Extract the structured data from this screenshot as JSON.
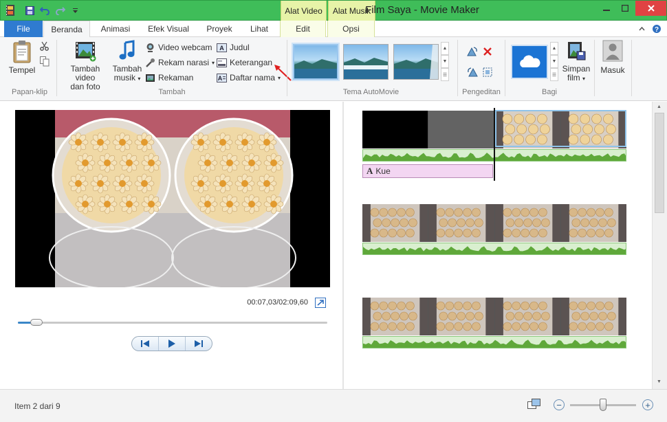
{
  "window": {
    "title": "Film Saya - Movie Maker",
    "context_tabs": [
      "Alat Video",
      "Alat Musik"
    ]
  },
  "tabs": {
    "file": "File",
    "items": [
      "Beranda",
      "Animasi",
      "Efek Visual",
      "Proyek",
      "Lihat"
    ],
    "video_edit": "Edit",
    "music_options": "Opsi"
  },
  "ribbon": {
    "clipboard": {
      "paste_label": "Tempel",
      "group_label": "Papan-klip"
    },
    "add": {
      "add_video_label_1": "Tambah video",
      "add_video_label_2": "dan foto",
      "add_music_label_1": "Tambah",
      "add_music_label_2": "musik",
      "webcam_video": "Video webcam",
      "record_narration": "Rekam narasi",
      "snapshot": "Rekaman",
      "title": "Judul",
      "caption": "Keterangan",
      "credits": "Daftar nama",
      "group_label": "Tambah"
    },
    "automovie_themes": {
      "group_label": "Tema AutoMovie"
    },
    "editing": {
      "group_label": "Pengeditan"
    },
    "share": {
      "save_movie_label_1": "Simpan",
      "save_movie_label_2": "film",
      "group_label": "Bagi"
    },
    "sign_in": {
      "label": "Masuk"
    }
  },
  "preview": {
    "time": "00:07,03/02:09,60",
    "seek_progress": 0.055
  },
  "storyboard": {
    "caption_clip_text": "Kue"
  },
  "status": {
    "item_text": "Item 2 dari 9",
    "zoom_level": 0.5
  },
  "colors": {
    "title_bar": "#3fbd59",
    "context_tab": "#e7f3a8",
    "file_tab": "#2f7bd0",
    "caption_clip": "#f3d6f2",
    "audio_wave": "#5fa83a",
    "selection": "#9cc7ee"
  }
}
